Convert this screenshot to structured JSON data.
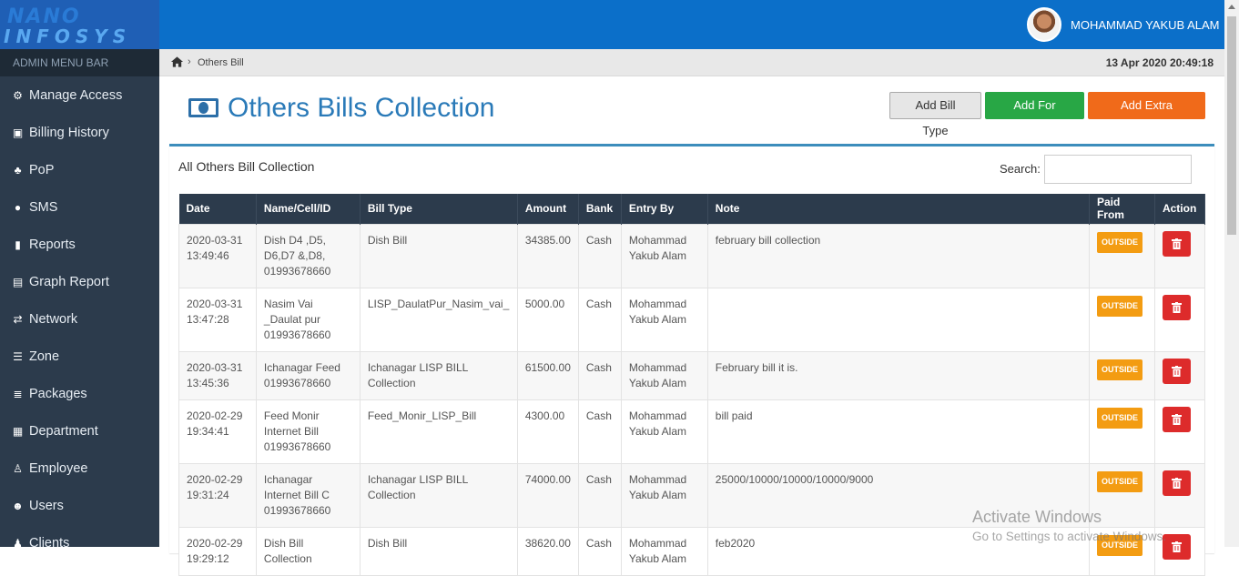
{
  "header": {
    "logo_top": "NANO",
    "logo_bottom": "INFOSYS",
    "user_name": "MOHAMMAD YAKUB ALAM"
  },
  "sidebar": {
    "heading": "ADMIN MENU BAR",
    "items": [
      {
        "label": "Manage Access",
        "icon": "cogs-icon"
      },
      {
        "label": "Billing History",
        "icon": "money-icon"
      },
      {
        "label": "PoP",
        "icon": "sitemap-icon"
      },
      {
        "label": "SMS",
        "icon": "comment-icon"
      },
      {
        "label": "Reports",
        "icon": "signal-icon"
      },
      {
        "label": "Graph Report",
        "icon": "bar-chart-icon"
      },
      {
        "label": "Network",
        "icon": "exchange-icon"
      },
      {
        "label": "Zone",
        "icon": "list-icon"
      },
      {
        "label": "Packages",
        "icon": "tasks-icon"
      },
      {
        "label": "Department",
        "icon": "th-large-icon"
      },
      {
        "label": "Employee",
        "icon": "user-md-icon"
      },
      {
        "label": "Users",
        "icon": "users-icon"
      },
      {
        "label": "Clients",
        "icon": "user-icon"
      }
    ]
  },
  "breadcrumb": {
    "current": "Others Bill",
    "datetime": "13 Apr 2020 20:49:18"
  },
  "page": {
    "title": "Others Bills Collection",
    "buttons": {
      "add_bill_type": "Add Bill Type",
      "add_for_client": "Add For Client",
      "add_extra_income": "Add Extra Income"
    }
  },
  "box": {
    "title": "All Others Bill Collection",
    "search_label": "Search:",
    "search_value": ""
  },
  "table": {
    "columns": [
      "Date",
      "Name/Cell/ID",
      "Bill Type",
      "Amount",
      "Bank",
      "Entry By",
      "Note",
      "Paid From",
      "Action"
    ],
    "rows": [
      {
        "date": "2020-03-31 13:49:46",
        "name": "Dish D4 ,D5, D6,D7 &,D8, 01993678660",
        "bill_type": "Dish Bill",
        "amount": "34385.00",
        "bank": "Cash",
        "entry_by": "Mohammad Yakub Alam",
        "note": "february bill collection",
        "paid_from": "OUTSIDE"
      },
      {
        "date": "2020-03-31 13:47:28",
        "name": "Nasim Vai _Daulat pur 01993678660",
        "bill_type": "LISP_DaulatPur_Nasim_vai_",
        "amount": "5000.00",
        "bank": "Cash",
        "entry_by": "Mohammad Yakub Alam",
        "note": "",
        "paid_from": "OUTSIDE"
      },
      {
        "date": "2020-03-31 13:45:36",
        "name": "Ichanagar Feed 01993678660",
        "bill_type": "Ichanagar LISP BILL Collection",
        "amount": "61500.00",
        "bank": "Cash",
        "entry_by": "Mohammad Yakub Alam",
        "note": "February bill it is.",
        "paid_from": "OUTSIDE"
      },
      {
        "date": "2020-02-29 19:34:41",
        "name": "Feed Monir Internet Bill 01993678660",
        "bill_type": "Feed_Monir_LISP_Bill",
        "amount": "4300.00",
        "bank": "Cash",
        "entry_by": "Mohammad Yakub Alam",
        "note": "bill paid",
        "paid_from": "OUTSIDE"
      },
      {
        "date": "2020-02-29 19:31:24",
        "name": "Ichanagar Internet Bill C 01993678660",
        "bill_type": "Ichanagar LISP BILL Collection",
        "amount": "74000.00",
        "bank": "Cash",
        "entry_by": "Mohammad Yakub Alam",
        "note": "25000/10000/10000/10000/9000",
        "paid_from": "OUTSIDE"
      },
      {
        "date": "2020-02-29 19:29:12",
        "name": "Dish Bill Collection",
        "bill_type": "Dish Bill",
        "amount": "38620.00",
        "bank": "Cash",
        "entry_by": "Mohammad Yakub Alam",
        "note": "feb2020",
        "paid_from": "OUTSIDE"
      }
    ]
  },
  "watermark": {
    "line1": "Activate Windows",
    "line2": "Go to Settings to activate Windows."
  },
  "colors": {
    "topbar": "#0b6fc9",
    "sidebar": "#2c3b4c",
    "table_header": "#2c3b4c",
    "success": "#28a745",
    "orange": "#f06a1a",
    "badge": "#f39c12",
    "danger": "#dd2b2b",
    "title_blue": "#2a7ab8"
  }
}
